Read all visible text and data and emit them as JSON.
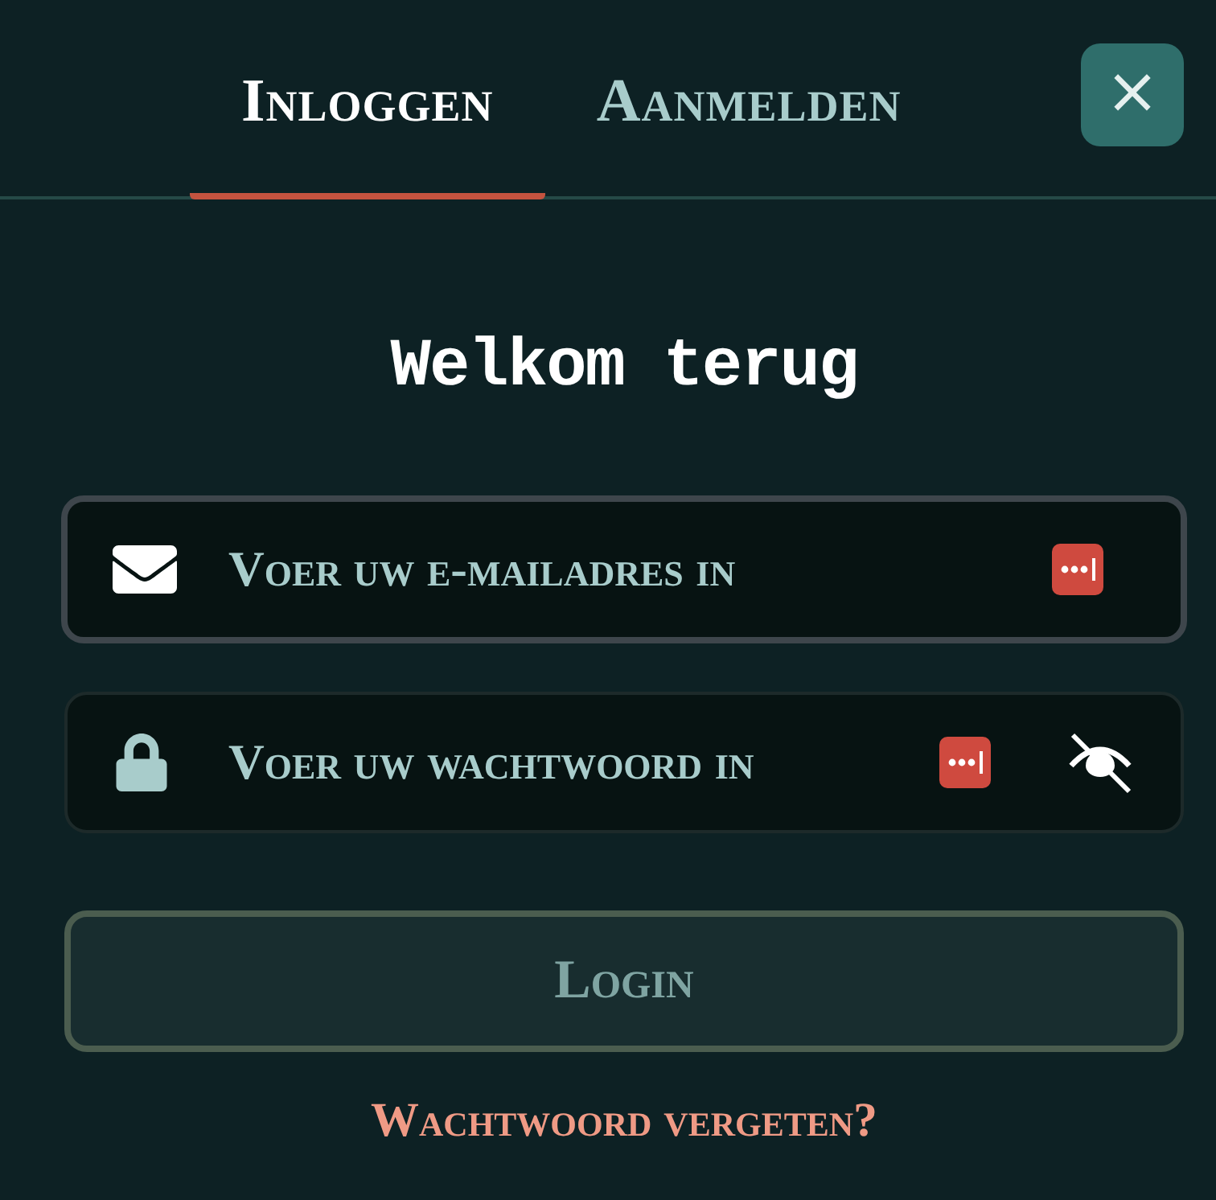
{
  "tabs": [
    {
      "label": "Inloggen",
      "selected": true
    },
    {
      "label": "Aanmelden",
      "selected": false
    }
  ],
  "close_button": {
    "label": "×"
  },
  "heading": "Welkom terug",
  "fields": [
    {
      "kind": "email",
      "placeholder": "Voer uw e-mailadres in",
      "focused": true,
      "password_manager": true
    },
    {
      "kind": "password",
      "placeholder": "Voer uw wachtwoord in",
      "focused": false,
      "password_manager": true,
      "visibility_toggle": true
    }
  ],
  "login_button": {
    "label": "Login",
    "disabled": true
  },
  "forgot_link": "Wachtwoord vergeten?"
}
